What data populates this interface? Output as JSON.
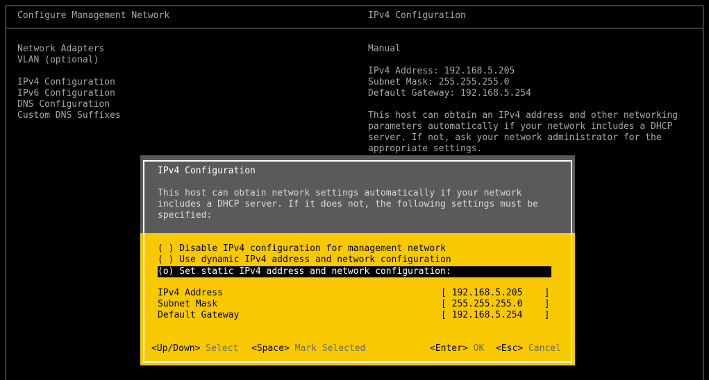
{
  "left_panel": {
    "title": "Configure Management Network",
    "menu_items": [
      "Network Adapters",
      "VLAN (optional)",
      "",
      "IPv4 Configuration",
      "IPv6 Configuration",
      "DNS Configuration",
      "Custom DNS Suffixes"
    ]
  },
  "right_panel": {
    "title": "IPv4 Configuration",
    "mode": "Manual",
    "ipv4_address_line": "IPv4 Address: 192.168.5.205",
    "subnet_mask_line": "Subnet Mask: 255.255.255.0",
    "gateway_line": "Default Gateway: 192.168.5.254",
    "description_lines": [
      "This host can obtain an IPv4 address and other networking",
      "parameters automatically if your network includes a DHCP",
      "server. If not, ask your network administrator for the",
      "appropriate settings."
    ]
  },
  "dialog": {
    "title": "IPv4 Configuration",
    "description_lines": [
      "This host can obtain network settings automatically if your network",
      "includes a DHCP server. If it does not, the following settings must be",
      "specified:"
    ],
    "options": [
      "( ) Disable IPv4 configuration for management network",
      "( ) Use dynamic IPv4 address and network configuration",
      "(o) Set static IPv4 address and network configuration:"
    ],
    "selected_option": 2,
    "fields": [
      {
        "label": "IPv4 Address",
        "value": "[ 192.168.5.205    ]"
      },
      {
        "label": "Subnet Mask",
        "value": "[ 255.255.255.0    ]"
      },
      {
        "label": "Default Gateway",
        "value": "[ 192.168.5.254    ]"
      }
    ],
    "footer": {
      "updown_key": "<Up/Down>",
      "updown_hint": "Select",
      "space_key": "<Space>",
      "space_hint": "Mark Selected",
      "enter_key": "<Enter>",
      "enter_hint": "OK",
      "esc_key": "<Esc>",
      "esc_hint": "Cancel"
    }
  }
}
